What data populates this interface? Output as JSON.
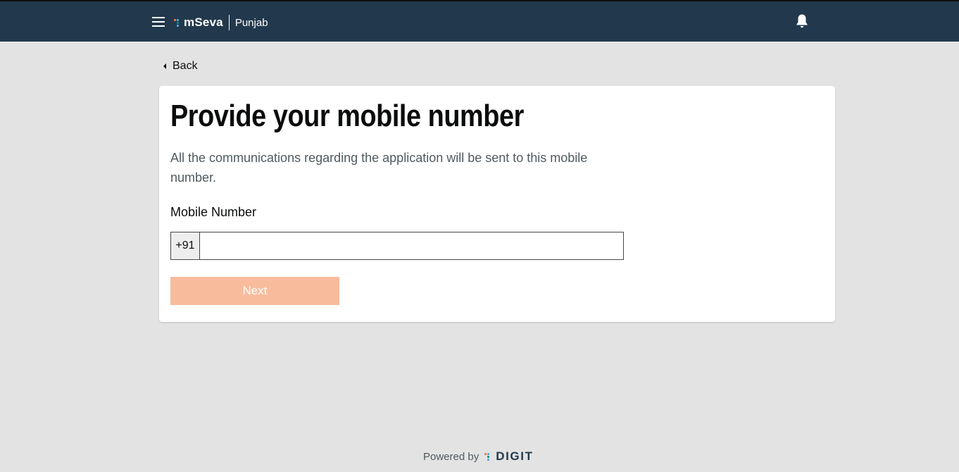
{
  "header": {
    "brand": "mSeva",
    "city": "Punjab",
    "menu_icon": "hamburger-menu-icon",
    "notification_icon": "bell-icon",
    "colors": {
      "bar": "#22394d",
      "dot_orange": "#f47738",
      "dot_teal": "#0b8a84",
      "dot_blue": "#4caae0"
    }
  },
  "nav": {
    "back_label": "Back",
    "back_icon": "caret-left-icon"
  },
  "card": {
    "title": "Provide your mobile number",
    "description": "All the communications regarding the application will be sent to this mobile number.",
    "field_label": "Mobile Number",
    "country_code": "+91",
    "mobile_value": "",
    "next_label": "Next",
    "next_color": "#f8bc9d"
  },
  "footer": {
    "powered_by": "Powered by",
    "brand": "DIGIT"
  }
}
